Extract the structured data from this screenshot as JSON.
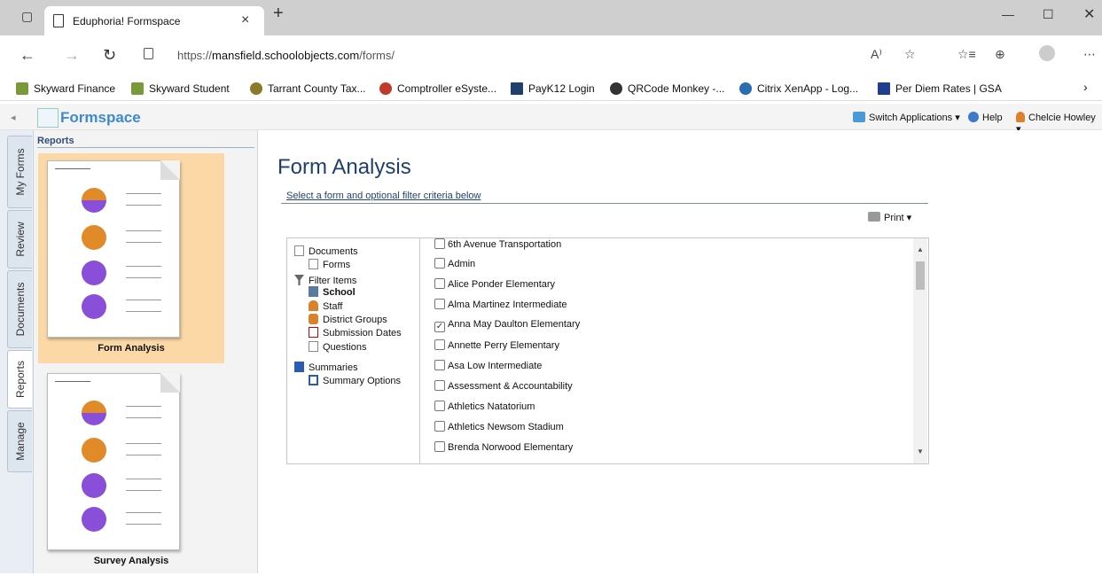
{
  "browser": {
    "tab_title": "Eduphoria! Formspace",
    "url_prefix": "https://",
    "url_host": "mansfield.schoolobjects.com",
    "url_path": "/forms/",
    "bookmarks": [
      "Skyward Finance",
      "Skyward Student",
      "Tarrant County Tax...",
      "Comptroller eSyste...",
      "PayK12 Login",
      "QRCode Monkey -...",
      "Citrix XenApp - Log...",
      "Per Diem Rates | GSA"
    ]
  },
  "app": {
    "logo": "Formspace",
    "switch_apps": "Switch Applications",
    "help": "Help",
    "user": "Chelcie Howley"
  },
  "vertical_tabs": [
    "My Forms",
    "Review",
    "Documents",
    "Reports",
    "Manage"
  ],
  "left_panel": {
    "title": "Reports",
    "cards": [
      "Form Analysis",
      "Survey Analysis"
    ]
  },
  "main": {
    "title": "Form Analysis",
    "subtitle": "Select a form and optional filter criteria below",
    "print": "Print"
  },
  "tree": {
    "documents": "Documents",
    "forms": "Forms",
    "filter_items": "Filter Items",
    "school": "School",
    "staff": "Staff",
    "district_groups": "District Groups",
    "submission_dates": "Submission Dates",
    "questions": "Questions",
    "summaries": "Summaries",
    "summary_options": "Summary Options"
  },
  "schools": [
    {
      "name": "6th Avenue Transportation",
      "checked": false
    },
    {
      "name": "Admin",
      "checked": false
    },
    {
      "name": "Alice Ponder Elementary",
      "checked": false
    },
    {
      "name": "Alma Martinez Intermediate",
      "checked": false
    },
    {
      "name": "Anna May Daulton Elementary",
      "checked": true
    },
    {
      "name": "Annette Perry Elementary",
      "checked": false
    },
    {
      "name": "Asa Low Intermediate",
      "checked": false
    },
    {
      "name": "Assessment & Accountability",
      "checked": false
    },
    {
      "name": "Athletics Natatorium",
      "checked": false
    },
    {
      "name": "Athletics Newsom Stadium",
      "checked": false
    },
    {
      "name": "Brenda Norwood Elementary",
      "checked": false
    }
  ]
}
